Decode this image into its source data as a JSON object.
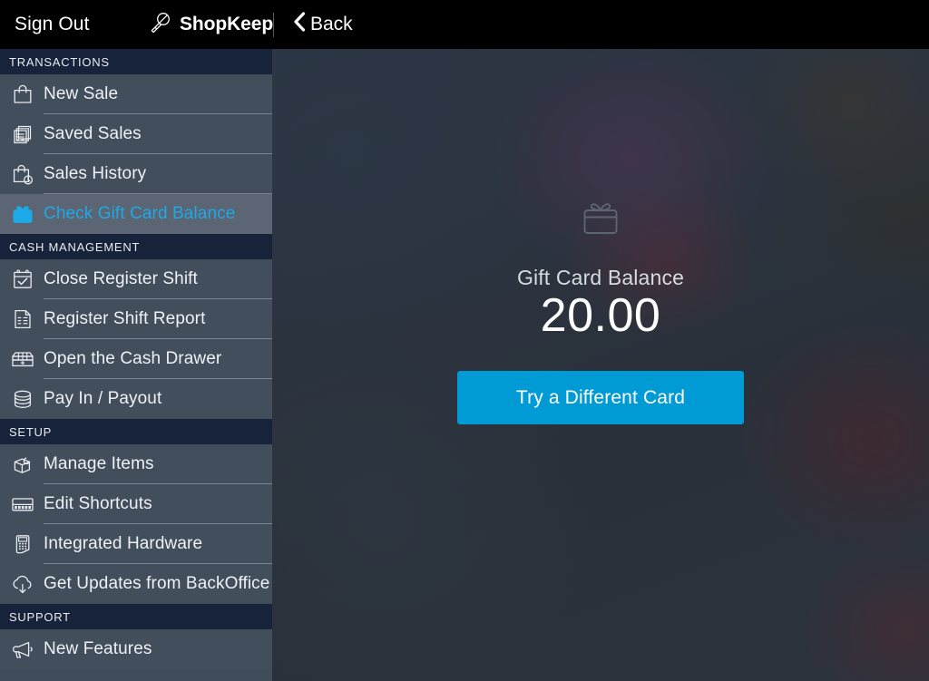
{
  "topbar": {
    "sign_out_label": "Sign Out",
    "brand_name": "ShopKeep",
    "brand_icon": "key-icon",
    "back_label": "Back",
    "back_icon": "chevron-left-icon"
  },
  "sidebar": {
    "sections": [
      {
        "title": "TRANSACTIONS",
        "items": [
          {
            "label": "New Sale",
            "icon": "shopping-bag-icon",
            "selected": false
          },
          {
            "label": "Saved Sales",
            "icon": "documents-stack-icon",
            "selected": false
          },
          {
            "label": "Sales History",
            "icon": "bag-clock-icon",
            "selected": false
          },
          {
            "label": "Check Gift Card Balance",
            "icon": "gift-card-icon",
            "selected": true
          }
        ]
      },
      {
        "title": "CASH MANAGEMENT",
        "items": [
          {
            "label": "Close Register Shift",
            "icon": "calendar-check-icon",
            "selected": false
          },
          {
            "label": "Register Shift Report",
            "icon": "report-document-icon",
            "selected": false
          },
          {
            "label": "Open the Cash Drawer",
            "icon": "cash-drawer-icon",
            "selected": false
          },
          {
            "label": "Pay In / Payout",
            "icon": "coins-stack-icon",
            "selected": false
          }
        ]
      },
      {
        "title": "SETUP",
        "items": [
          {
            "label": "Manage Items",
            "icon": "open-box-icon",
            "selected": false
          },
          {
            "label": "Edit Shortcuts",
            "icon": "keypad-grid-icon",
            "selected": false
          },
          {
            "label": "Integrated Hardware",
            "icon": "card-terminal-icon",
            "selected": false
          },
          {
            "label": "Get Updates from BackOffice",
            "icon": "cloud-download-icon",
            "selected": false
          }
        ]
      },
      {
        "title": "SUPPORT",
        "items": [
          {
            "label": "New Features",
            "icon": "megaphone-icon",
            "selected": false
          }
        ]
      }
    ]
  },
  "main": {
    "gift_icon": "gift-card-icon",
    "balance_label": "Gift Card Balance",
    "balance_amount": "20.00",
    "cta_label": "Try a Different Card"
  },
  "colors": {
    "accent": "#009ad4",
    "selected_text": "#1ea9e8",
    "sidebar_item_bg": "#434e5d",
    "sidebar_selected_bg": "#5b6573",
    "section_header_bg": "#16233a",
    "topbar_bg": "#000000"
  }
}
